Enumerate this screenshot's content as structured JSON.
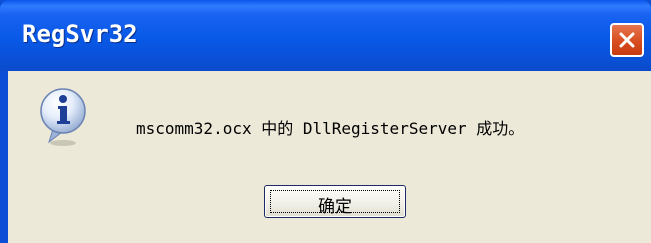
{
  "window": {
    "title": "RegSvr32"
  },
  "dialog": {
    "icon": "info-icon",
    "message": "mscomm32.ocx 中的 DllRegisterServer 成功。",
    "ok_label": "确定"
  },
  "colors": {
    "titlebar": "#0858e6",
    "frame": "#0c4fd6",
    "client": "#ece9d8",
    "close_button": "#d84d20"
  }
}
